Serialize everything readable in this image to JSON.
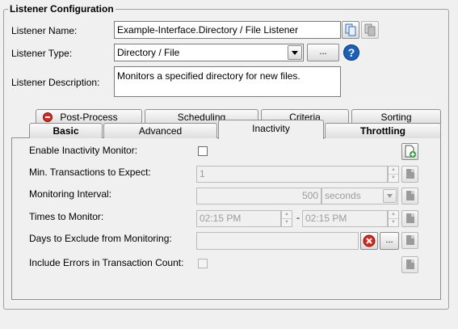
{
  "group": {
    "title": "Listener Configuration"
  },
  "listener": {
    "name_label": "Listener Name:",
    "name_value": "Example-Interface.Directory / File Listener",
    "type_label": "Listener Type:",
    "type_value": "Directory / File",
    "browse_label": "...",
    "help_glyph": "?",
    "description_label": "Listener Description:",
    "description_value": "Monitors a specified directory for new files."
  },
  "tabs": {
    "row1": [
      {
        "label": "Post-Process",
        "status": "error"
      },
      {
        "label": "Scheduling"
      },
      {
        "label": "Criteria"
      },
      {
        "label": "Sorting"
      }
    ],
    "row2": [
      {
        "label": "Basic"
      },
      {
        "label": "Advanced"
      },
      {
        "label": "Inactivity",
        "selected": true
      },
      {
        "label": "Throttling"
      }
    ]
  },
  "inactivity": {
    "enable_label": "Enable Inactivity Monitor:",
    "enable_checked": false,
    "min_tx_label": "Min. Transactions to Expect:",
    "min_tx_value": "1",
    "interval_label": "Monitoring Interval:",
    "interval_value": "500",
    "interval_unit": "seconds",
    "times_label": "Times to Monitor:",
    "time_from": "02:15 PM",
    "time_sep": "-",
    "time_to": "02:15 PM",
    "days_label": "Days to Exclude from Monitoring:",
    "days_value": "",
    "days_browse": "...",
    "include_errors_label": "Include Errors in Transaction Count:",
    "include_errors_checked": false
  },
  "icons": {
    "copy": "copy-icon",
    "paste": "paste-icon",
    "help": "help-icon",
    "error": "error-icon",
    "clear": "clear-icon",
    "add_document": "add-document-icon",
    "document": "document-icon",
    "dropdown": "dropdown-arrow-icon"
  },
  "colors": {
    "help_blue": "#1c5fb8",
    "error_red": "#d42a1e",
    "add_green": "#2e9c2e"
  }
}
